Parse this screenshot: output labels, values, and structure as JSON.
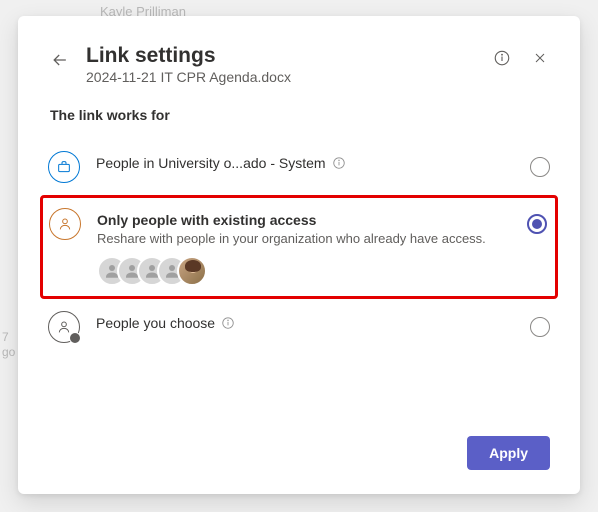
{
  "background": {
    "name_fragment": "Kayle Prilliman",
    "left_fragment_top": "7",
    "left_fragment_bottom": "go"
  },
  "header": {
    "title": "Link settings",
    "filename": "2024-11-21 IT CPR Agenda.docx"
  },
  "section_label": "The link works for",
  "options": {
    "org": {
      "title": "People in University o...ado - System"
    },
    "existing": {
      "title": "Only people with existing access",
      "description": "Reshare with people in your organization who already have access."
    },
    "choose": {
      "title": "People you choose"
    }
  },
  "footer": {
    "apply_label": "Apply"
  }
}
